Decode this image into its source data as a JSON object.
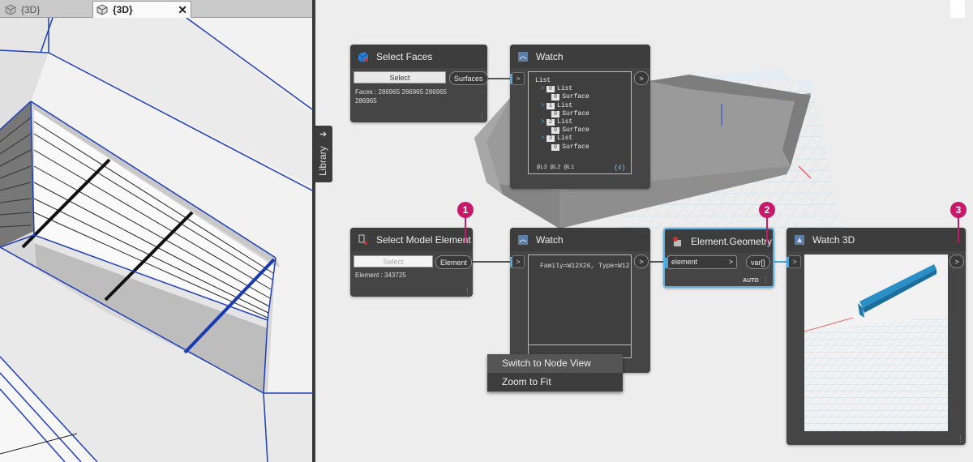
{
  "revit": {
    "tabs": [
      {
        "label": "{3D}",
        "active": false
      },
      {
        "label": "{3D}",
        "active": true
      }
    ],
    "close_glyph": "✕",
    "icons": {
      "view": "3d-view-cube-icon",
      "close": "close-icon"
    }
  },
  "library": {
    "label": "Library",
    "arrow": "➔"
  },
  "nodes": {
    "select_faces": {
      "title": "Select Faces",
      "button": "Select",
      "output": "Surfaces",
      "info": "Faces : 286965 286965 286965 286965",
      "icon": "select-faces-icon"
    },
    "watch_1": {
      "title": "Watch",
      "icon": "watch-icon",
      "input_port": ">",
      "output_port": ">",
      "tree": [
        {
          "text": "List",
          "level": 0
        },
        {
          "caret": ">",
          "idx": "0",
          "text": "List",
          "level": 1
        },
        {
          "idx": "0",
          "text": "Surface",
          "level": 2
        },
        {
          "caret": ">",
          "idx": "1",
          "text": "List",
          "level": 1
        },
        {
          "idx": "0",
          "text": "Surface",
          "level": 2
        },
        {
          "caret": ">",
          "idx": "2",
          "text": "List",
          "level": 1
        },
        {
          "idx": "0",
          "text": "Surface",
          "level": 2
        },
        {
          "caret": ">",
          "idx": "3",
          "text": "List",
          "level": 1
        },
        {
          "idx": "0",
          "text": "Surface",
          "level": 2
        }
      ],
      "footer_levels": "@L3 @L2 @L1",
      "footer_count": "{4}"
    },
    "select_model": {
      "title": "Select Model Element",
      "button": "Select",
      "output": "Element",
      "info": "Element : 343725",
      "icon": "select-model-element-icon"
    },
    "watch_2": {
      "title": "Watch",
      "icon": "watch-icon",
      "input_port": ">",
      "output_port": ">",
      "value": "Family=W12X26, Type=W12"
    },
    "element_geometry": {
      "title": "Element.Geometry",
      "icon": "element-geometry-icon",
      "input": "element",
      "input_arrow": ">",
      "output": "var[]",
      "lacing": "AUTO"
    },
    "watch_3d": {
      "title": "Watch 3D",
      "icon": "watch-3d-icon",
      "input_port": ">",
      "output_port": ">"
    }
  },
  "badges": [
    "1",
    "2",
    "3"
  ],
  "context_menu": {
    "items": [
      "Switch to Node View",
      "Zoom to Fit"
    ]
  },
  "colors": {
    "accent_blue": "#4da4d6",
    "badge": "#c8186a",
    "node_body": "#454545",
    "node_header": "#3d3d3d",
    "revit_edge": "#1f3fb8"
  }
}
